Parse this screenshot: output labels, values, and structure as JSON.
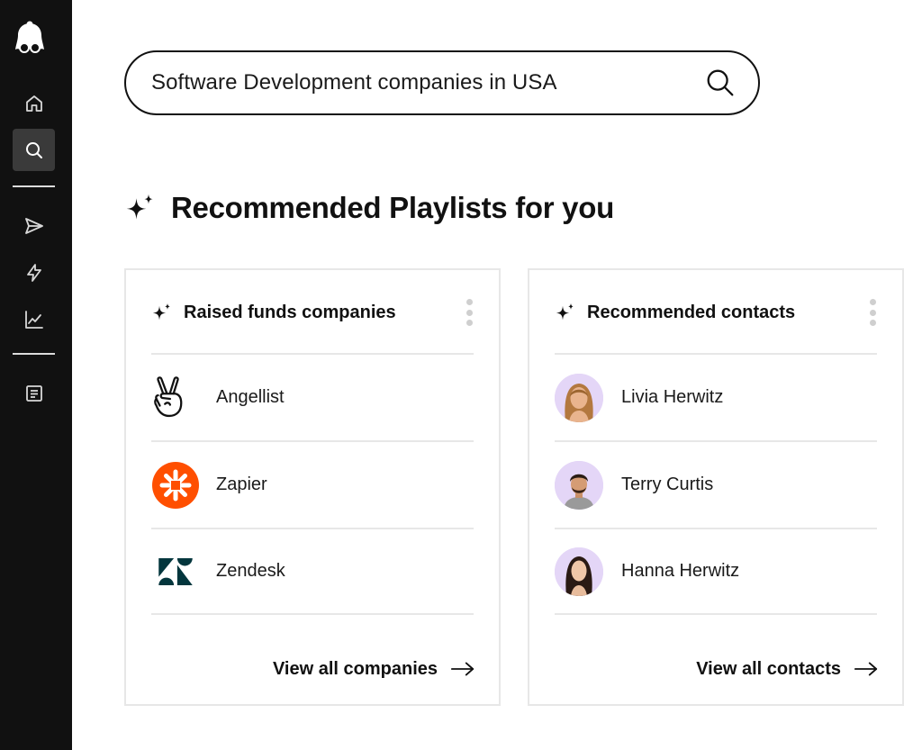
{
  "sidebar": {
    "logo": "avatar-logo-icon",
    "items": [
      {
        "icon": "home-icon",
        "active": false
      },
      {
        "icon": "search-icon",
        "active": true
      },
      {
        "icon": "send-icon",
        "active": false
      },
      {
        "icon": "lightning-icon",
        "active": false
      },
      {
        "icon": "chart-line-icon",
        "active": false
      },
      {
        "icon": "document-icon",
        "active": false
      }
    ]
  },
  "search": {
    "value": "Software Development companies in USA",
    "icon": "search-icon"
  },
  "heading": {
    "title": "Recommended Playlists for you",
    "icon": "sparkle-icon"
  },
  "companies_card": {
    "title": "Raised funds companies",
    "items": [
      {
        "name": "Angellist",
        "logo": "angellist-logo",
        "brand_color": "#111111"
      },
      {
        "name": "Zapier",
        "logo": "zapier-logo",
        "brand_color": "#ff4f00"
      },
      {
        "name": "Zendesk",
        "logo": "zendesk-logo",
        "brand_color": "#03363d"
      }
    ],
    "view_all": "View all companies"
  },
  "contacts_card": {
    "title": "Recommended contacts",
    "items": [
      {
        "name": "Livia Herwitz",
        "avatar": "avatar-livia"
      },
      {
        "name": "Terry Curtis",
        "avatar": "avatar-terry"
      },
      {
        "name": "Hanna Herwitz",
        "avatar": "avatar-hanna"
      }
    ],
    "view_all": "View all contacts"
  },
  "colors": {
    "sidebar_bg": "#111111",
    "avatar_bg": "#e4d6f7",
    "divider": "#e7e7e7"
  }
}
